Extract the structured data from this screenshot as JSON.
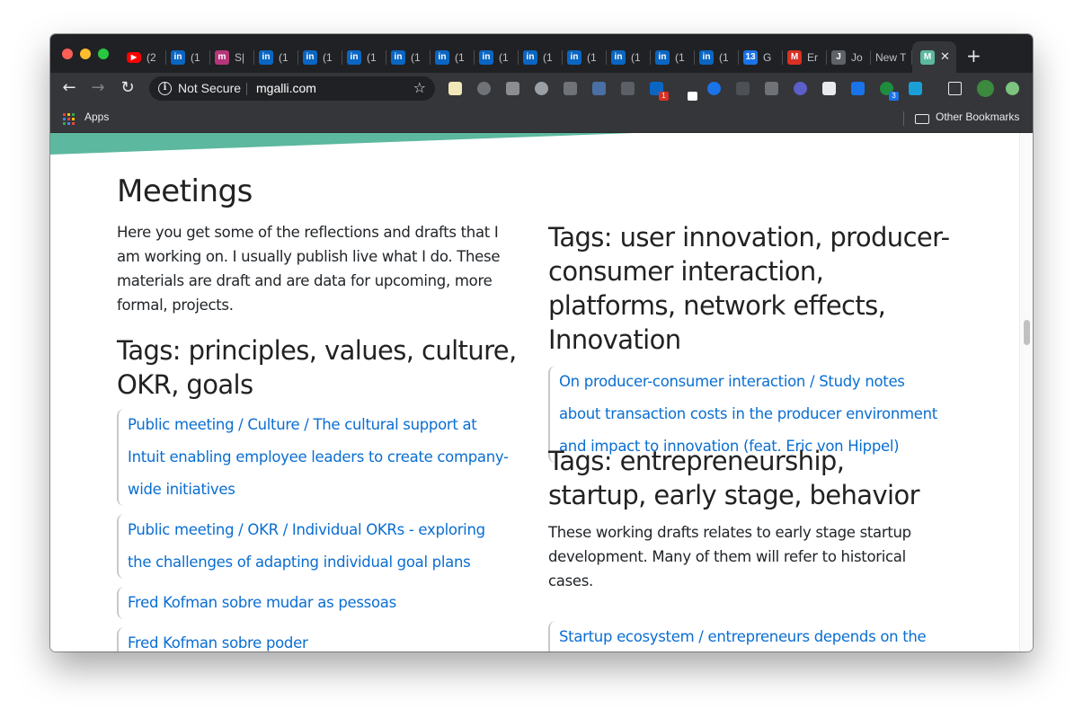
{
  "browser": {
    "tabs": [
      {
        "icon": "youtube-icon",
        "label": "(2",
        "color": "#ff0000"
      },
      {
        "icon": "linkedin-icon",
        "label": "(1",
        "color": "#0a66c2"
      },
      {
        "icon": "site-icon",
        "label": "S|",
        "color": "#b5367a"
      },
      {
        "icon": "linkedin-icon",
        "label": "(1",
        "color": "#0a66c2"
      },
      {
        "icon": "linkedin-icon",
        "label": "(1",
        "color": "#0a66c2"
      },
      {
        "icon": "linkedin-icon",
        "label": "(1",
        "color": "#0a66c2"
      },
      {
        "icon": "linkedin-icon",
        "label": "(1",
        "color": "#0a66c2"
      },
      {
        "icon": "linkedin-icon",
        "label": "(1",
        "color": "#0a66c2"
      },
      {
        "icon": "linkedin-icon",
        "label": "(1",
        "color": "#0a66c2"
      },
      {
        "icon": "linkedin-icon",
        "label": "(1",
        "color": "#0a66c2"
      },
      {
        "icon": "linkedin-icon",
        "label": "(1",
        "color": "#0a66c2"
      },
      {
        "icon": "linkedin-icon",
        "label": "(1",
        "color": "#0a66c2"
      },
      {
        "icon": "linkedin-icon",
        "label": "(1",
        "color": "#0a66c2"
      },
      {
        "icon": "linkedin-icon",
        "label": "(1",
        "color": "#0a66c2"
      },
      {
        "icon": "calendar-icon",
        "label": "G",
        "color": "#1a73e8",
        "glyph": "13"
      },
      {
        "icon": "gmail-icon",
        "label": "Er",
        "color": "#d93025",
        "glyph": "M"
      },
      {
        "icon": "j-icon",
        "label": "Jo",
        "color": "#5f6368",
        "glyph": "J"
      },
      {
        "icon": "blank-icon",
        "label": "New T",
        "color": "#202124",
        "glyph": ""
      }
    ],
    "active_tab": {
      "icon": "mgalli-icon",
      "close": "✕",
      "color": "#5cb89f",
      "glyph": "M"
    },
    "new_tab": "+",
    "address": {
      "security": "Not Secure",
      "url": "mgalli.com"
    },
    "bookmarks": {
      "apps": "Apps",
      "other": "Other Bookmarks"
    }
  },
  "page": {
    "title": "Meetings",
    "intro": "Here you get some of the reflections and drafts that I am working on. I usually publish live what I do. These materials are draft and are data for upcoming, more formal, projects.",
    "left_section": {
      "heading": "Tags: principles, values, culture, OKR, goals",
      "links": [
        "Public meeting / Culture / The cultural support at Intuit enabling employee leaders to create company-wide initiatives",
        "Public meeting / OKR / Individual OKRs - exploring the challenges of adapting individual goal plans",
        "Fred Kofman sobre mudar as pessoas",
        "Fred Kofman sobre poder"
      ]
    },
    "right_section_1": {
      "heading": "Tags: user innovation, producer-consumer interaction, platforms, network effects, Innovation",
      "links": [
        "On producer-consumer interaction / Study notes about transaction costs in the producer environment and impact to innovation (feat. Eric von Hippel)"
      ]
    },
    "right_section_2": {
      "heading": "Tags: entrepreneurship, startup, early stage, behavior",
      "text": "These working drafts relates to early stage startup development. Many of them will refer to historical cases.",
      "links": [
        "Startup ecosystem / entrepreneurs depends on the startup ecosystem - reflecting about the realities of"
      ]
    }
  },
  "colors": {
    "link": "#0a6ed1",
    "banner": "#5cb89f",
    "chrome_dark": "#202124",
    "chrome_toolbar": "#35363a"
  }
}
